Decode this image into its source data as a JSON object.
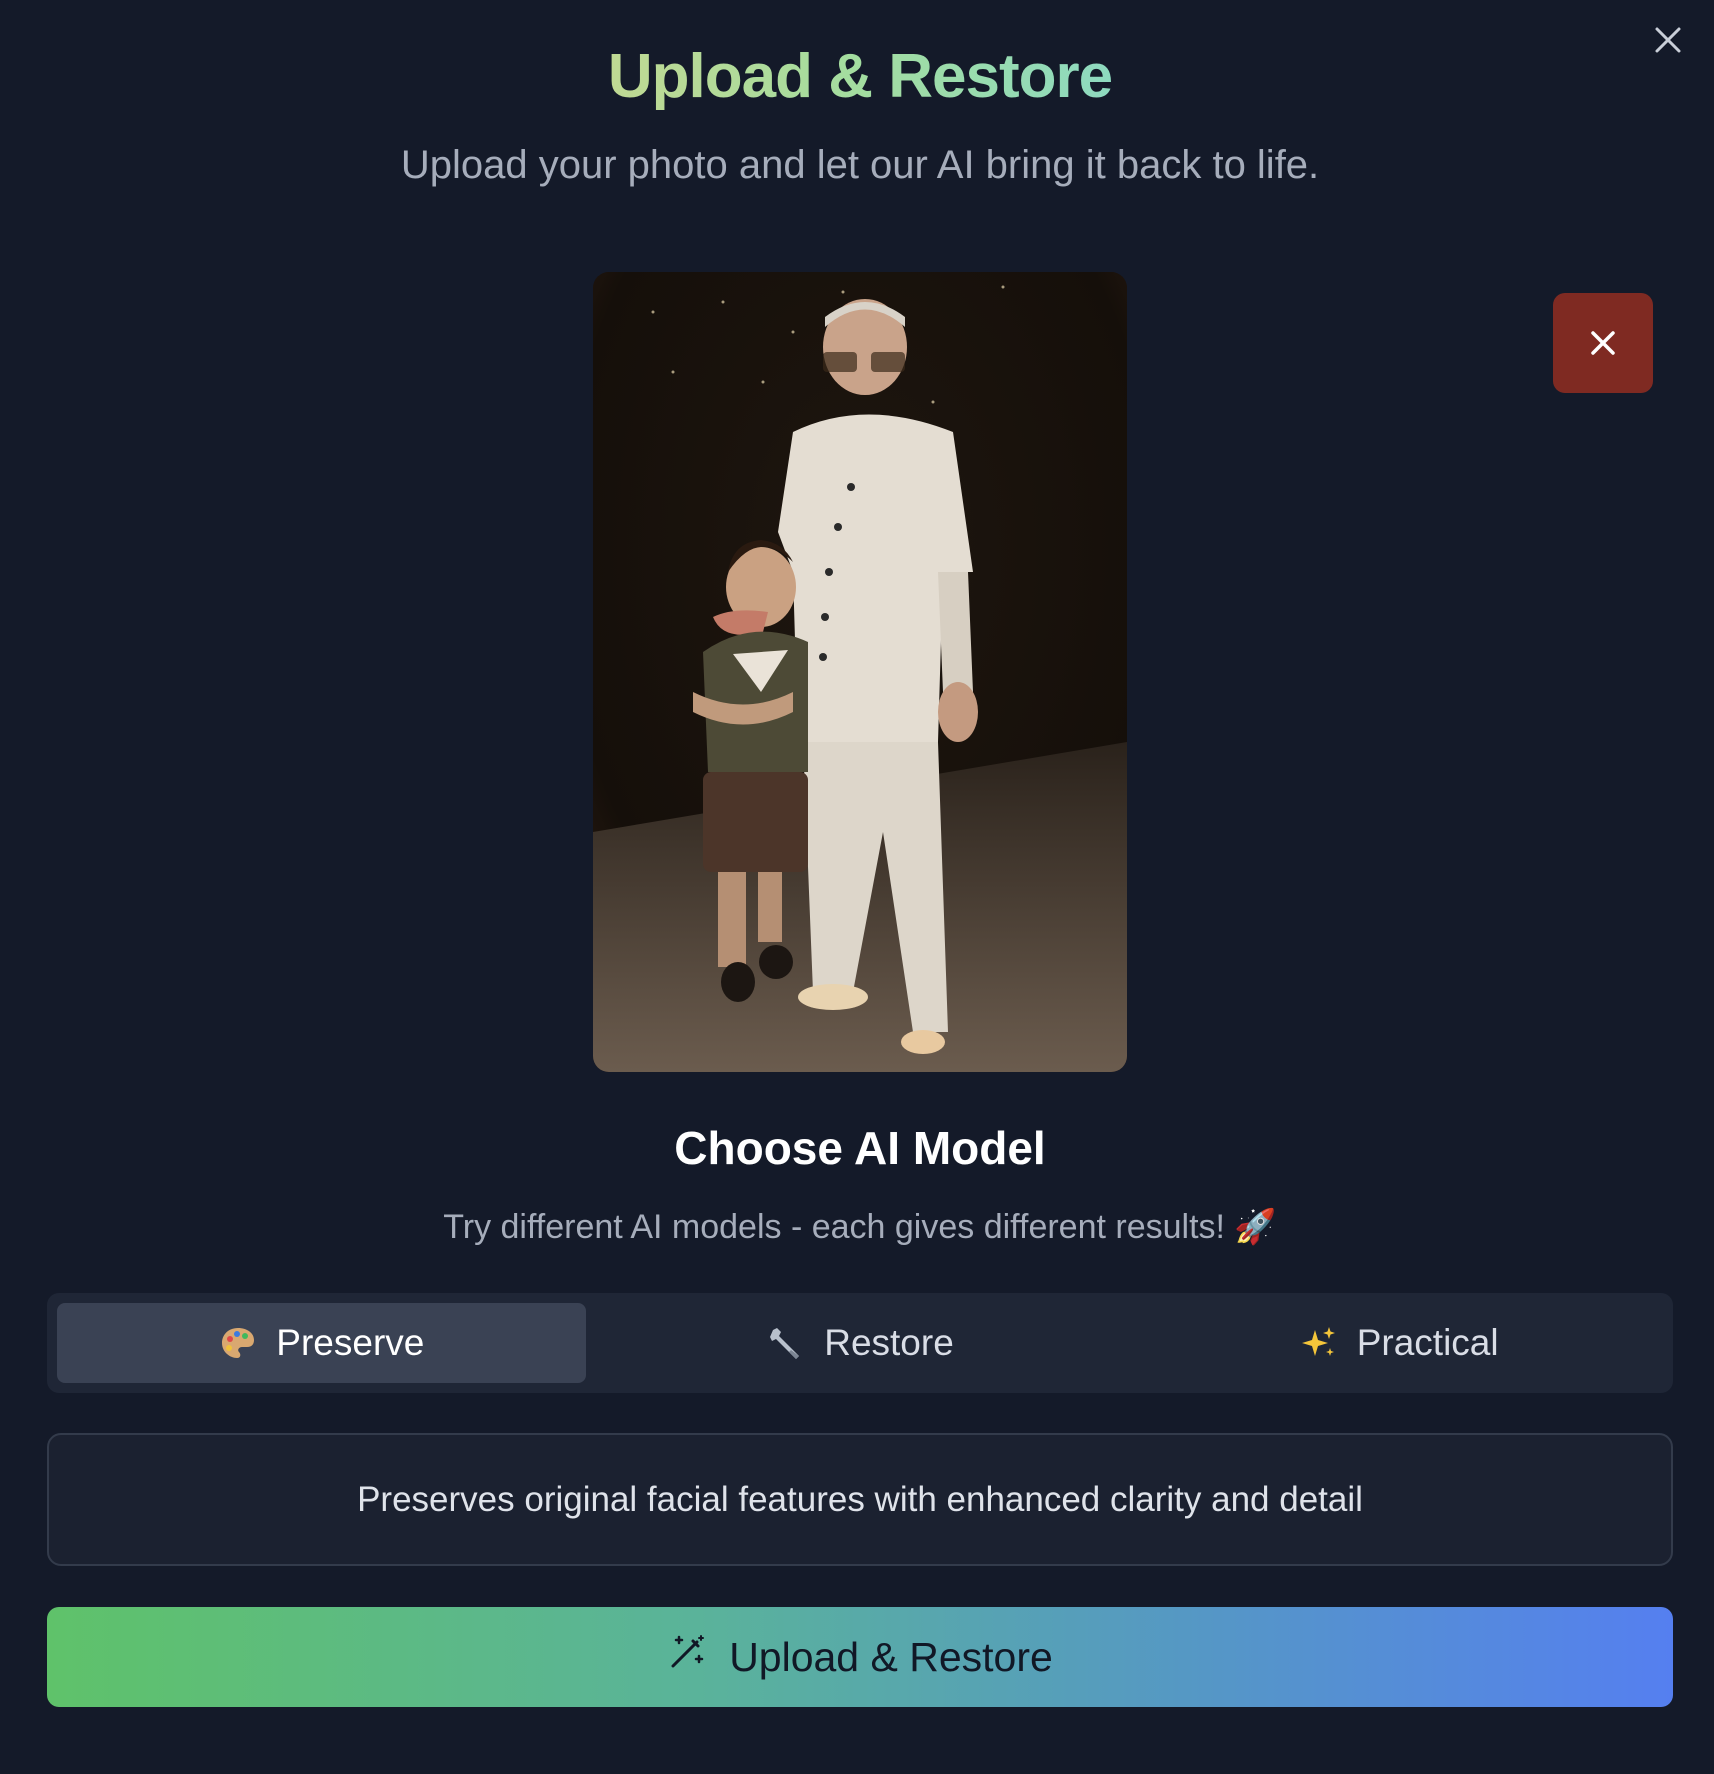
{
  "modal": {
    "title": "Upload & Restore",
    "subtitle": "Upload your photo and let our AI bring it back to life.",
    "close_icon": "close-icon"
  },
  "preview": {
    "remove_icon": "close-icon",
    "remove_button_color": "#7f2a22"
  },
  "model_section": {
    "title": "Choose AI Model",
    "subtitle": "Try different AI models - each gives different results! 🚀",
    "tabs": [
      {
        "label": "Preserve",
        "icon": "palette-icon",
        "active": true
      },
      {
        "label": "Restore",
        "icon": "wrench-icon",
        "active": false
      },
      {
        "label": "Practical",
        "icon": "sparkles-icon",
        "active": false
      }
    ],
    "description": "Preserves original facial features with enhanced clarity and detail"
  },
  "cta": {
    "label": "Upload & Restore",
    "icon": "magic-wand-icon",
    "gradient": [
      "#5fc26a",
      "#557ff0"
    ]
  }
}
